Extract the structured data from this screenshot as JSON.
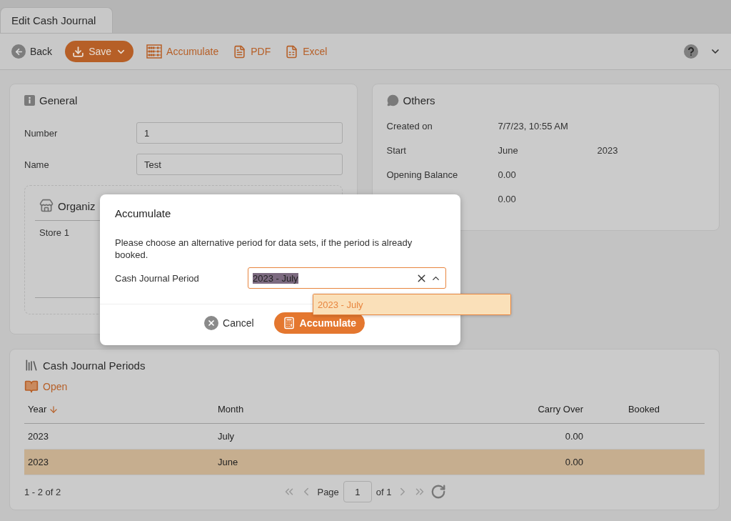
{
  "tab": {
    "title": "Edit Cash Journal",
    "selected": true
  },
  "toolbar": {
    "buttons": [
      {
        "kind": "back",
        "label": "Back"
      },
      {
        "kind": "save",
        "label": "Save"
      },
      {
        "kind": "accumulate",
        "label": "Accumulate"
      },
      {
        "kind": "pdf",
        "label": "PDF"
      },
      {
        "kind": "excel",
        "label": "Excel"
      }
    ]
  },
  "general": {
    "title": "General",
    "fields": [
      {
        "label": "Number",
        "value": "1"
      },
      {
        "label": "Name",
        "value": "Test"
      }
    ],
    "organization": {
      "title": "Organiz",
      "rows": [
        "Store 1"
      ]
    }
  },
  "others": {
    "title": "Others",
    "rows": [
      {
        "label": "Created on",
        "values": [
          "7/7/23, 10:55 AM"
        ]
      },
      {
        "label": "Start",
        "values": [
          "June",
          "2023"
        ]
      },
      {
        "label": "Opening Balance",
        "values": [
          "0.00"
        ]
      },
      {
        "values": [
          "0.00"
        ]
      }
    ]
  },
  "periods": {
    "title": "Cash Journal Periods",
    "open_label": "Open",
    "columns": [
      {
        "label": "Year",
        "sorted": true
      },
      {
        "label": "Month",
        "sorted": false
      },
      {
        "label": "Carry Over",
        "sorted": false
      },
      {
        "label": "Booked",
        "sorted": false
      }
    ],
    "rows": [
      {
        "cells": [
          "2023",
          "July",
          "0.00"
        ],
        "selected": false
      },
      {
        "cells": [
          "2023",
          "June",
          "0.00"
        ],
        "selected": true
      }
    ],
    "pager": {
      "summary": "1 - 2 of 2",
      "page_label": "Page",
      "page": "1",
      "of_label": "of 1"
    }
  },
  "dialog": {
    "title": "Accumulate",
    "message": "Please choose an alternative period for data sets, if the period is already booked.",
    "field_label": "Cash Journal Period",
    "value": "2023 - July",
    "options": [
      {
        "label": "2023 - July",
        "selected": true
      }
    ],
    "buttons": [
      {
        "kind": "cancel",
        "label": "Cancel"
      },
      {
        "kind": "primary",
        "label": "Accumulate"
      }
    ]
  }
}
